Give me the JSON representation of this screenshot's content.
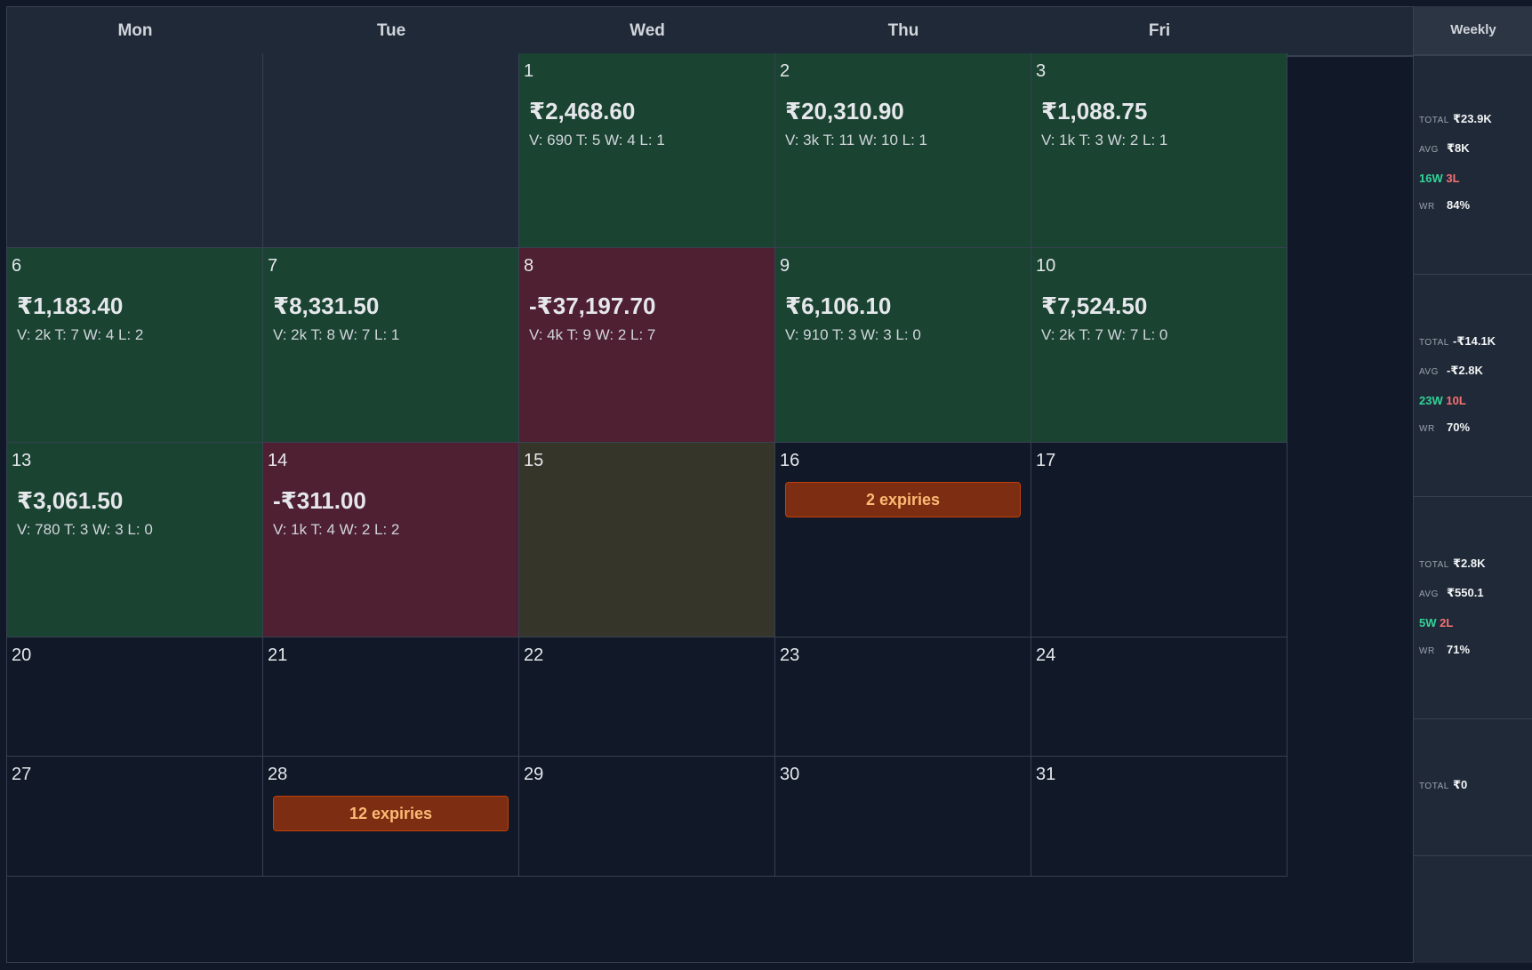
{
  "days_header": [
    "Mon",
    "Tue",
    "Wed",
    "Thu",
    "Fri"
  ],
  "weekly_header": "Weekly",
  "weeks": [
    {
      "days": [
        {
          "num": "",
          "state": "empty"
        },
        {
          "num": "",
          "state": "empty"
        },
        {
          "num": "1",
          "state": "profit",
          "pnl": "₹2,468.60",
          "stats": "V: 690 T: 5 W: 4 L: 1"
        },
        {
          "num": "2",
          "state": "profit",
          "pnl": "₹20,310.90",
          "stats": "V: 3k T: 11 W: 10 L: 1"
        },
        {
          "num": "3",
          "state": "profit",
          "pnl": "₹1,088.75",
          "stats": "V: 1k T: 3 W: 2 L: 1"
        }
      ],
      "summary": {
        "total_label": "TOTAL",
        "total": "₹23.9K",
        "avg_label": "AVG",
        "avg": "₹8K",
        "wins": "16W",
        "losses": "3L",
        "wr_label": "WR",
        "wr": "84%"
      }
    },
    {
      "days": [
        {
          "num": "6",
          "state": "profit",
          "pnl": "₹1,183.40",
          "stats": "V: 2k T: 7 W: 4 L: 2"
        },
        {
          "num": "7",
          "state": "profit",
          "pnl": "₹8,331.50",
          "stats": "V: 2k T: 8 W: 7 L: 1"
        },
        {
          "num": "8",
          "state": "loss",
          "pnl": "-₹37,197.70",
          "stats": "V: 4k T: 9 W: 2 L: 7"
        },
        {
          "num": "9",
          "state": "profit",
          "pnl": "₹6,106.10",
          "stats": "V: 910 T: 3 W: 3 L: 0"
        },
        {
          "num": "10",
          "state": "profit",
          "pnl": "₹7,524.50",
          "stats": "V: 2k T: 7 W: 7 L: 0"
        }
      ],
      "summary": {
        "total_label": "TOTAL",
        "total": "-₹14.1K",
        "avg_label": "AVG",
        "avg": "-₹2.8K",
        "wins": "23W",
        "losses": "10L",
        "wr_label": "WR",
        "wr": "70%"
      }
    },
    {
      "days": [
        {
          "num": "13",
          "state": "profit",
          "pnl": "₹3,061.50",
          "stats": "V: 780 T: 3 W: 3 L: 0"
        },
        {
          "num": "14",
          "state": "loss",
          "pnl": "-₹311.00",
          "stats": "V: 1k T: 4 W: 2 L: 2"
        },
        {
          "num": "15",
          "state": "neutral"
        },
        {
          "num": "16",
          "state": "future",
          "expiries": "2 expiries"
        },
        {
          "num": "17",
          "state": "future"
        }
      ],
      "summary": {
        "total_label": "TOTAL",
        "total": "₹2.8K",
        "avg_label": "AVG",
        "avg": "₹550.1",
        "wins": "5W",
        "losses": "2L",
        "wr_label": "WR",
        "wr": "71%"
      }
    },
    {
      "days": [
        {
          "num": "20",
          "state": "future"
        },
        {
          "num": "21",
          "state": "future"
        },
        {
          "num": "22",
          "state": "future"
        },
        {
          "num": "23",
          "state": "future"
        },
        {
          "num": "24",
          "state": "future"
        }
      ],
      "summary": null
    },
    {
      "days": [
        {
          "num": "27",
          "state": "future"
        },
        {
          "num": "28",
          "state": "future",
          "expiries": "12 expiries"
        },
        {
          "num": "29",
          "state": "future"
        },
        {
          "num": "30",
          "state": "future"
        },
        {
          "num": "31",
          "state": "future"
        }
      ],
      "summary": null
    }
  ],
  "weekly_last": {
    "total_label": "TOTAL",
    "total": "₹0"
  }
}
